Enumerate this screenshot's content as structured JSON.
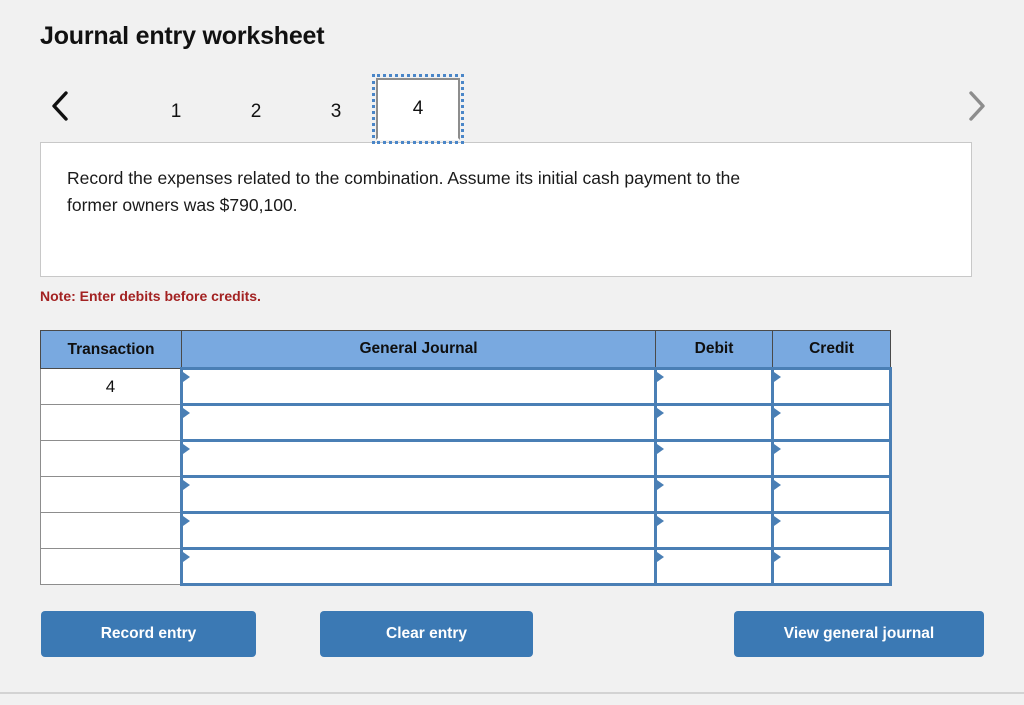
{
  "header": {
    "title": "Journal entry worksheet"
  },
  "pager": {
    "prev_icon": "chevron-left-icon",
    "next_icon": "chevron-right-icon",
    "tabs": [
      {
        "label": "1",
        "selected": false
      },
      {
        "label": "2",
        "selected": false
      },
      {
        "label": "3",
        "selected": false
      },
      {
        "label": "4",
        "selected": true
      }
    ]
  },
  "instruction": {
    "text": "Record the expenses related to the combination. Assume its initial cash payment to the former owners was $790,100."
  },
  "note": {
    "text": "Note: Enter debits before credits."
  },
  "table": {
    "columns": [
      "Transaction",
      "General Journal",
      "Debit",
      "Credit"
    ],
    "rows": [
      {
        "transaction": "4",
        "general_journal": "",
        "debit": "",
        "credit": ""
      },
      {
        "transaction": "",
        "general_journal": "",
        "debit": "",
        "credit": ""
      },
      {
        "transaction": "",
        "general_journal": "",
        "debit": "",
        "credit": ""
      },
      {
        "transaction": "",
        "general_journal": "",
        "debit": "",
        "credit": ""
      },
      {
        "transaction": "",
        "general_journal": "",
        "debit": "",
        "credit": ""
      },
      {
        "transaction": "",
        "general_journal": "",
        "debit": "",
        "credit": ""
      }
    ]
  },
  "actions": {
    "record": "Record entry",
    "clear": "Clear entry",
    "view": "View general journal"
  },
  "colors": {
    "page_background": "#f1f1f1",
    "header_blue": "#79a9e0",
    "button_blue": "#3b79b4",
    "input_border_blue": "#4a7fb5",
    "note_red": "#a32222",
    "tab_focus_blue": "#4a86c8"
  }
}
